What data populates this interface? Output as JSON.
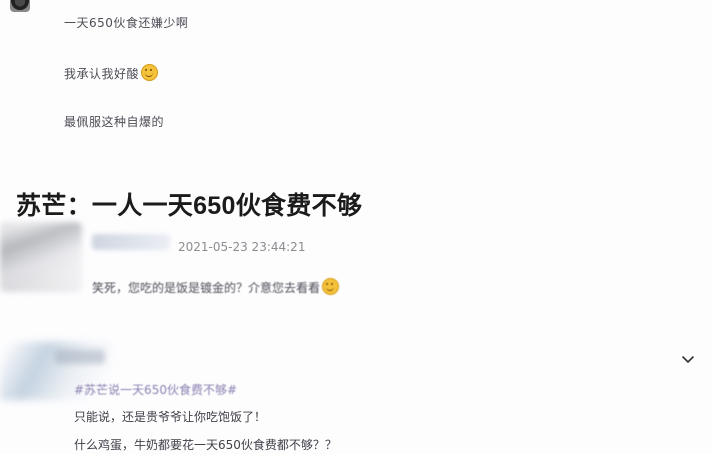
{
  "post": {
    "line1": "一天650伙食还嫌少啊",
    "line2": "我承认我好酸",
    "line3": "最佩服这种自爆的"
  },
  "headline": "苏芒：一人一天650伙食费不够",
  "comment_thread": {
    "timestamp": "2021-05-23 23:44:21",
    "text": "笑死，您吃的是饭是镀金的？介意您去看看"
  },
  "weibo_comment": {
    "hashtag": "#苏芒说一天650伙食费不够#",
    "line1": "只能说，还是贵爷爷让你吃饱饭了！",
    "line2": "什么鸡蛋，牛奶都要花一天650伙食费都不够？？"
  },
  "icons": {
    "emoji": "grin-emoji-icon",
    "expand": "chevron-down-icon",
    "avatar": "avatar"
  }
}
